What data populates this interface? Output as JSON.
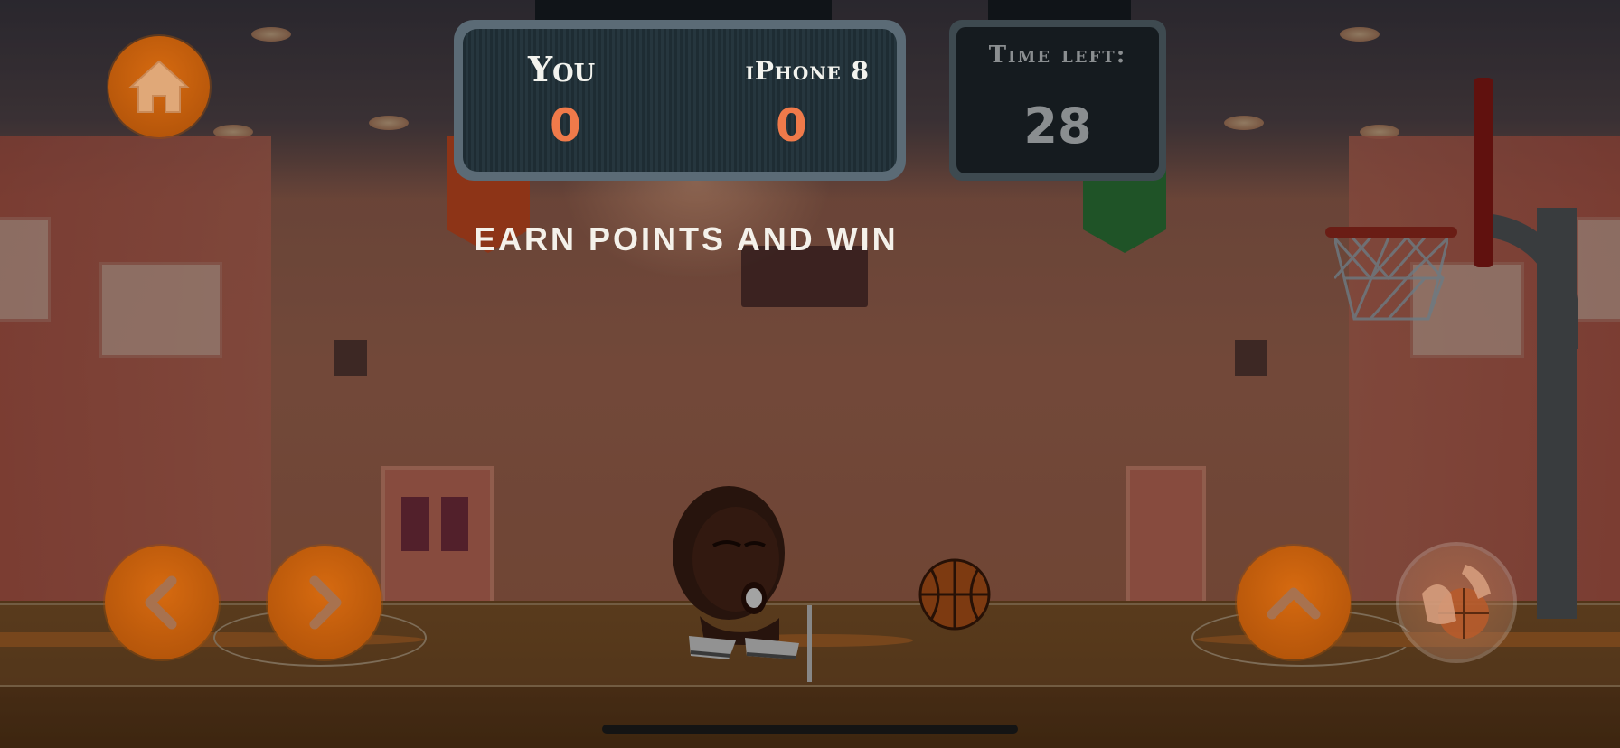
{
  "scoreboard": {
    "player_label": "You",
    "player_score": "0",
    "opponent_label": "iPhone 8",
    "opponent_score": "0"
  },
  "timer": {
    "label": "Time left:",
    "value": "28"
  },
  "message": "EARN POINTS AND WIN",
  "controls": {
    "home": "home-icon",
    "left": "chevron-left-icon",
    "right": "chevron-right-icon",
    "jump": "chevron-up-icon",
    "shoot": "shoot-hands-ball-icon"
  },
  "colors": {
    "button_orange": "#c45f0c",
    "score_orange": "#f07a4a",
    "rim_red": "#9d2b20"
  }
}
